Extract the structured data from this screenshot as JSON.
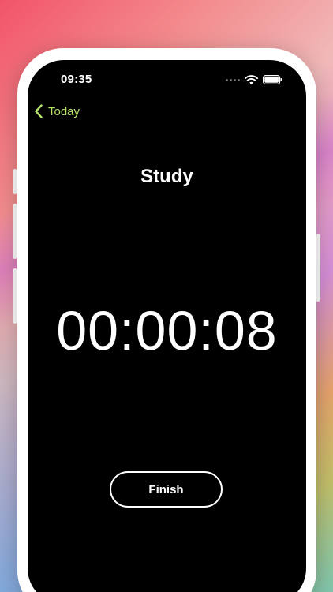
{
  "status_bar": {
    "time": "09:35"
  },
  "nav": {
    "back_label": "Today",
    "accent_color": "#b8e36a"
  },
  "session": {
    "title": "Study",
    "elapsed": "00:00:08"
  },
  "actions": {
    "finish_label": "Finish"
  }
}
